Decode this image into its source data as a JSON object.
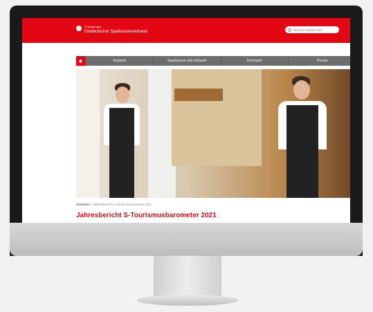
{
  "header": {
    "logo_small": "Finanzgruppe",
    "logo_main": "Ostdeutscher Sparkassenverband",
    "search_placeholder": "Wonach suchen Sie?"
  },
  "nav": {
    "items": [
      {
        "label": "Verband"
      },
      {
        "label": "Sparkassen und Verband"
      },
      {
        "label": "Ehrenamt"
      },
      {
        "label": "Presse"
      }
    ]
  },
  "breadcrumb": {
    "home": "Startseite",
    "separator": ">",
    "current": "Jahresbericht S-Tourismusbarometer 2021"
  },
  "main": {
    "title": "Jahresbericht S-Tourismusbarometer 2021"
  },
  "colors": {
    "brand_red": "#e30613",
    "nav_gray": "#6d6d6d"
  }
}
